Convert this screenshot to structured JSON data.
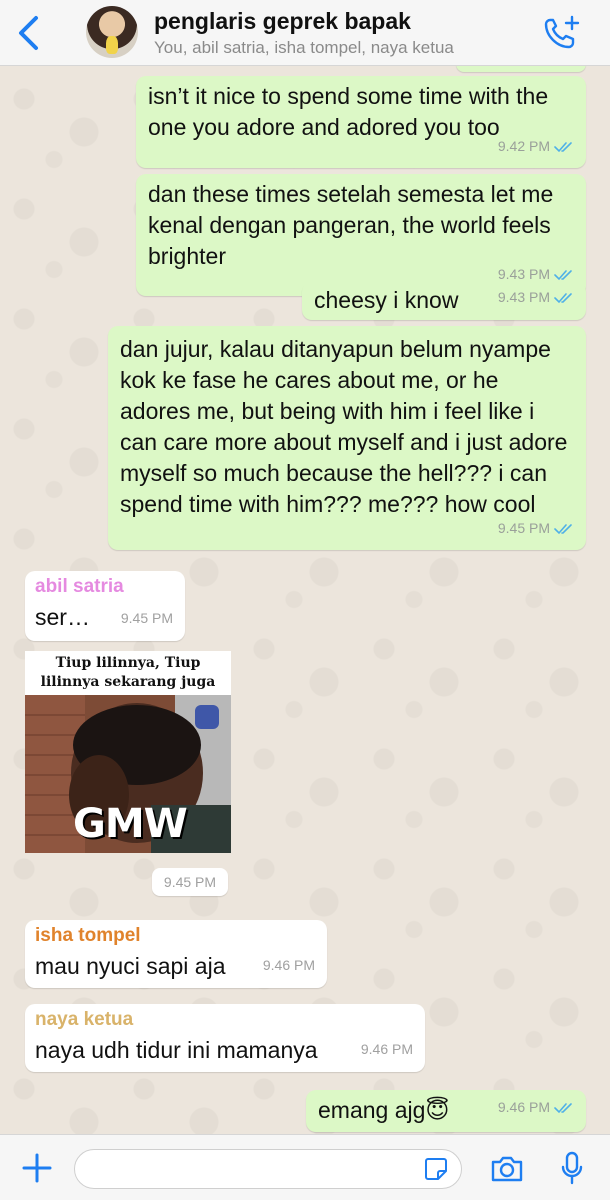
{
  "header": {
    "title": "penglaris geprek bapak",
    "subtitle": "You, abil satria, isha tompel, naya ketua",
    "back_icon": "chevron-left-icon",
    "call_icon": "add-call-icon"
  },
  "colors": {
    "accent": "#1e7ef1",
    "outgoing_bubble": "#dcf8c6",
    "incoming_bubble": "#ffffff",
    "chat_background": "#ece5dc",
    "read_ticks": "#4fb0e8"
  },
  "messages": [
    {
      "direction": "out",
      "text": "isn’t it nice to spend some time with the one you adore and adored you too",
      "time": "9.42 PM",
      "status": "read"
    },
    {
      "direction": "out",
      "text": "dan these times setelah semesta let me kenal dengan pangeran, the world feels brighter",
      "time": "9.43 PM",
      "status": "read"
    },
    {
      "direction": "out",
      "text": "cheesy i know",
      "time": "9.43 PM",
      "status": "read"
    },
    {
      "direction": "out",
      "text": "dan jujur, kalau ditanyapun belum nyampe kok ke fase he cares about me, or he adores me, but being with him i feel like i can care more about myself and i just adore myself so much because the hell??? i can spend time with him??? me??? how cool",
      "time": "9.45 PM",
      "status": "read"
    },
    {
      "direction": "in",
      "sender": "abil satria",
      "sender_color": "#e58ae0",
      "text": "ser…",
      "time": "9.45 PM"
    },
    {
      "direction": "in",
      "sender": "abil satria",
      "type": "sticker",
      "sticker_caption": "Tiup lilinnya, Tiup lilinnya sekarang juga",
      "sticker_badge": "GMW",
      "time": "9.45 PM"
    },
    {
      "direction": "in",
      "sender": "isha tompel",
      "sender_color": "#e0832c",
      "text": "mau nyuci sapi aja",
      "time": "9.46 PM"
    },
    {
      "direction": "in",
      "sender": "naya ketua",
      "sender_color": "#d9b36a",
      "text": "naya udh tidur ini mamanya",
      "time": "9.46 PM"
    },
    {
      "direction": "out",
      "text": "emang ajg😇",
      "time": "9.46 PM",
      "status": "read"
    }
  ],
  "input_bar": {
    "placeholder": "",
    "plus_icon": "plus-icon",
    "sticker_icon": "sticker-icon",
    "camera_icon": "camera-icon",
    "mic_icon": "microphone-icon"
  }
}
